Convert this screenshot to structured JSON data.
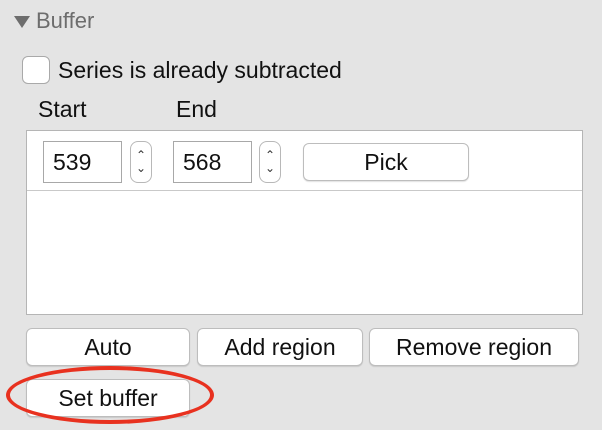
{
  "section": {
    "title": "Buffer",
    "icon": "disclosure-triangle-down-icon"
  },
  "subtracted_checkbox": {
    "label": "Series is already subtracted",
    "checked": false
  },
  "columns": {
    "start_label": "Start",
    "end_label": "End"
  },
  "regions": [
    {
      "start": "539",
      "end": "568",
      "pick_label": "Pick",
      "stepper_up": "⌃",
      "stepper_down": "⌄"
    }
  ],
  "actions": {
    "auto_label": "Auto",
    "add_region_label": "Add region",
    "remove_region_label": "Remove region",
    "set_buffer_label": "Set buffer"
  },
  "annotation": {
    "highlight_color": "#e8311f"
  }
}
